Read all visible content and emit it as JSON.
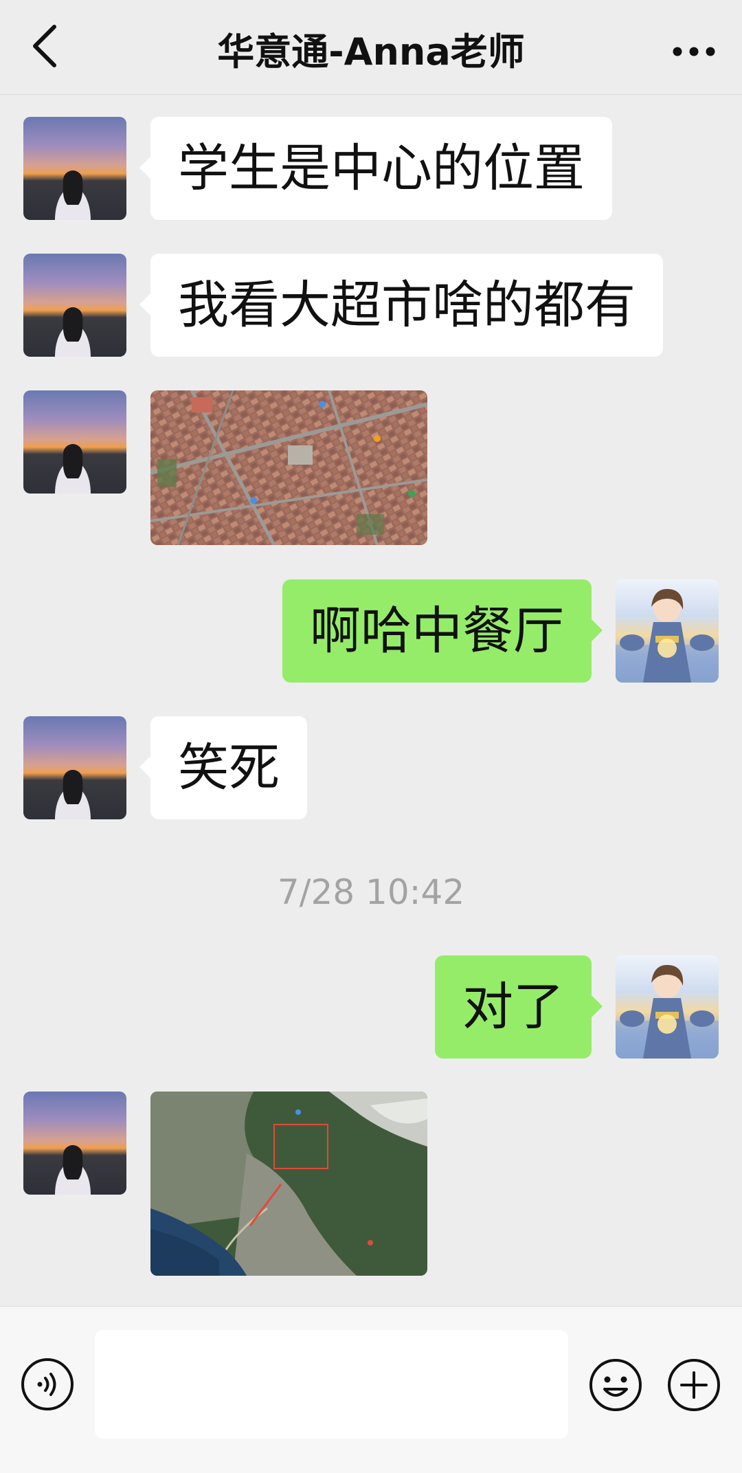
{
  "header": {
    "title": "华意通-Anna老师",
    "back_icon": "chevron-left-icon",
    "more_icon": "ellipsis-icon"
  },
  "messages": [
    {
      "side": "left",
      "type": "text",
      "text": "学生是中心的位置"
    },
    {
      "side": "left",
      "type": "text",
      "text": "我看大超市啥的都有"
    },
    {
      "side": "left",
      "type": "image",
      "image": "aerial-city-map"
    },
    {
      "side": "right",
      "type": "text",
      "text": "啊哈中餐厅"
    },
    {
      "side": "left",
      "type": "text",
      "text": "笑死"
    },
    {
      "side": "center",
      "type": "timestamp",
      "text": "7/28 10:42"
    },
    {
      "side": "right",
      "type": "text",
      "text": "对了"
    },
    {
      "side": "left",
      "type": "image",
      "image": "coastal-satellite-map"
    }
  ],
  "input_bar": {
    "voice_icon": "voice-icon",
    "text_value": "",
    "emoji_icon": "emoji-icon",
    "plus_icon": "plus-icon"
  },
  "colors": {
    "background": "#ededed",
    "self_bubble": "#95ec69",
    "other_bubble": "#ffffff",
    "timestamp_text": "#a3a3a3"
  }
}
